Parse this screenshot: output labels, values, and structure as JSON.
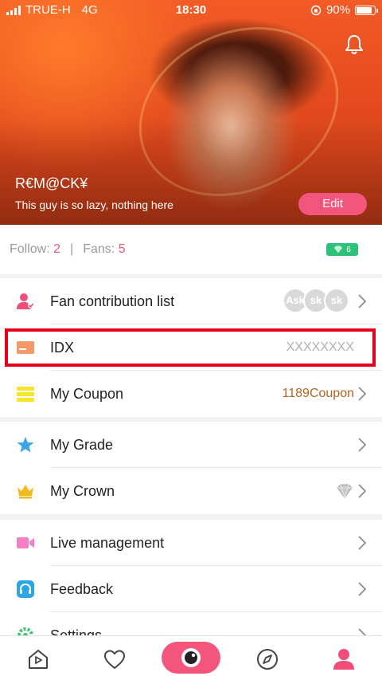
{
  "status": {
    "carrier": "TRUE-H",
    "network": "4G",
    "time": "18:30",
    "battery": "90%"
  },
  "profile": {
    "nickname": "R€M@CK¥",
    "bio": "This guy is so lazy, nothing here",
    "edit_label": "Edit"
  },
  "stats": {
    "follow_label": "Follow:",
    "follow_count": "2",
    "separator": "|",
    "fans_label": "Fans:",
    "fans_count": "5",
    "gem_count": "6"
  },
  "menu": {
    "fan_contribution": {
      "label": "Fan contribution list",
      "avatars": [
        "Ask",
        "sk",
        "sk"
      ]
    },
    "idx": {
      "label": "IDX",
      "value": "XXXXXXXX"
    },
    "coupon": {
      "label": "My Coupon",
      "value": "1189Coupon"
    },
    "grade": {
      "label": "My Grade"
    },
    "crown": {
      "label": "My Crown"
    },
    "live": {
      "label": "Live management"
    },
    "feedback": {
      "label": "Feedback"
    },
    "settings": {
      "label": "Settings"
    }
  },
  "colors": {
    "accent": "#f4557d",
    "coupon_value": "#b5651d",
    "highlight": "#e4001b",
    "gem": "#2fc07a"
  },
  "tabs": [
    "home-icon",
    "heart-icon",
    "live-camera-icon",
    "compass-icon",
    "profile-icon"
  ]
}
